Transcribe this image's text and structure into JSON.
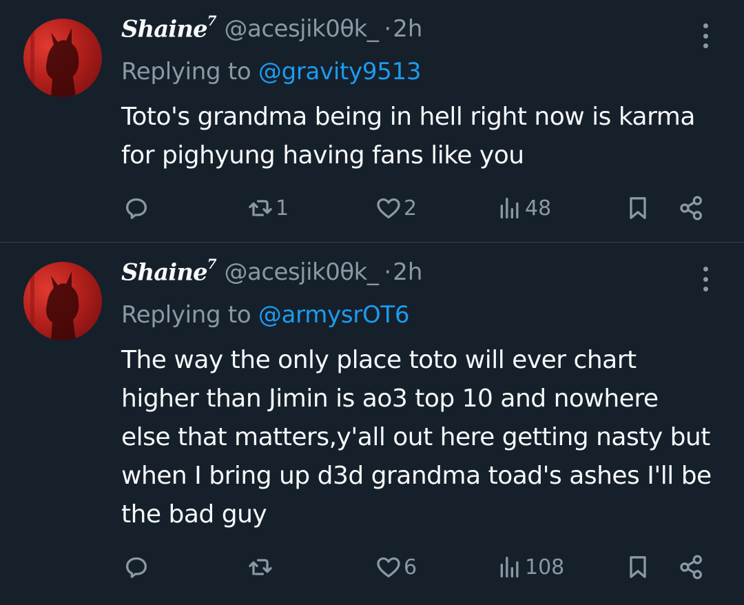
{
  "tweets": [
    {
      "author": {
        "name": "Shaine",
        "name_sup": "7",
        "handle": "@acesjik0θk_",
        "separator": "·",
        "time": "2h"
      },
      "replying_label": "Replying to ",
      "replying_to": "@gravity9513",
      "text": "Toto's grandma being in hell right now is karma for pighyung having fans like you",
      "stats": {
        "replies": "",
        "retweets": "1",
        "likes": "2",
        "views": "48"
      }
    },
    {
      "author": {
        "name": "Shaine",
        "name_sup": "7",
        "handle": "@acesjik0θk_",
        "separator": "·",
        "time": "2h"
      },
      "replying_label": "Replying to ",
      "replying_to": "@armysrOT6",
      "text": "The way the only place toto will ever chart higher than Jimin is ao3 top 10 and nowhere else that matters,y'all out here getting nasty but when I bring up d3d grandma toad's ashes I'll be the bad guy",
      "stats": {
        "replies": "",
        "retweets": "",
        "likes": "6",
        "views": "108"
      }
    }
  ],
  "icons": {
    "reply": "reply-icon",
    "retweet": "retweet-icon",
    "like": "heart-icon",
    "views": "views-icon",
    "bookmark": "bookmark-icon",
    "share": "share-icon",
    "more": "more-icon"
  },
  "colors": {
    "background": "#15202b",
    "text": "#f7f9f9",
    "muted": "#8b98a5",
    "link": "#1d9bf0",
    "divider": "#38444d"
  }
}
